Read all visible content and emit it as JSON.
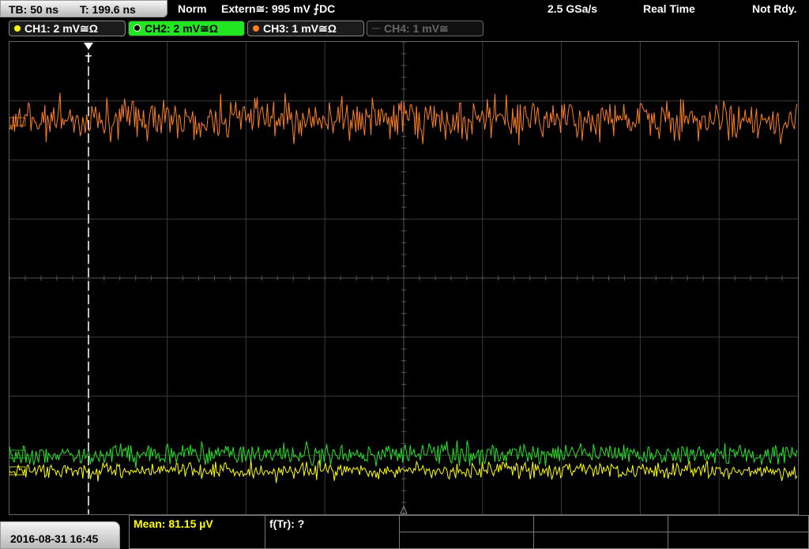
{
  "header": {
    "timebase": "TB: 50 ns",
    "trigger_time": "T: 199.6 ns",
    "trigger_mode": "Norm",
    "trigger_source": "Extern≅: 995 mV ⨍DC",
    "sample_rate": "2.5 GSa/s",
    "acq_mode": "Real Time",
    "status": "Not Rdy."
  },
  "channels": [
    {
      "label": "CH1: 2 mV≅Ω",
      "color": "#ffff00",
      "active": false,
      "enabled": true
    },
    {
      "label": "CH2: 2 mV≅Ω",
      "color": "#22e622",
      "active": true,
      "enabled": true
    },
    {
      "label": "CH3: 1 mV≅Ω",
      "color": "#ff8020",
      "active": false,
      "enabled": true
    },
    {
      "label": "CH4: 1 mV≅",
      "color": "#555555",
      "active": false,
      "enabled": false
    }
  ],
  "markers": {
    "trigger_marker": "T"
  },
  "footer": {
    "datetime": "2016-08-31 16:45",
    "measurement1": "Mean: 81.15 µV",
    "measurement1_color": "#ffff00",
    "measurement2": "f(Tr): ?"
  }
}
